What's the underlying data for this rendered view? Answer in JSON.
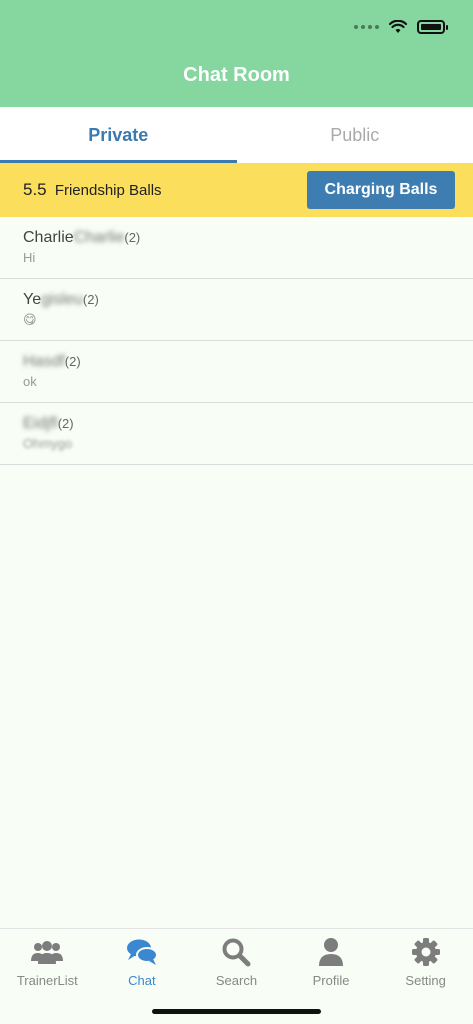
{
  "header": {
    "title": "Chat Room",
    "color": "#85d69f"
  },
  "tabs": [
    {
      "label": "Private",
      "active": true
    },
    {
      "label": "Public",
      "active": false
    }
  ],
  "balls": {
    "count": "5.5",
    "label": "Friendship Balls",
    "button_label": "Charging Balls"
  },
  "chats": [
    {
      "name": "Charlie",
      "name_blurred": "Charlie",
      "count": "(2)",
      "message": "Hi",
      "message_blurred": false
    },
    {
      "name": "Ye",
      "name_blurred": "gisleu",
      "count": "(2)",
      "message": "😋",
      "message_blurred": false
    },
    {
      "name": "",
      "name_blurred": "Hasdf",
      "count": "(2)",
      "message": "ok",
      "message_blurred": false
    },
    {
      "name": "",
      "name_blurred": "Eidjfl",
      "count": "(2)",
      "message": "Ohmygo",
      "message_blurred": true
    }
  ],
  "tabbar": {
    "items": [
      {
        "label": "TrainerList",
        "icon": "users-icon",
        "active": false
      },
      {
        "label": "Chat",
        "icon": "chat-bubbles-icon",
        "active": true
      },
      {
        "label": "Search",
        "icon": "search-icon",
        "active": false
      },
      {
        "label": "Profile",
        "icon": "user-icon",
        "active": false
      },
      {
        "label": "Setting",
        "icon": "gear-icon",
        "active": false
      }
    ]
  },
  "colors": {
    "accent": "#3b7ab1",
    "banner": "#fade5c",
    "tab_active": "#3b88d1"
  }
}
